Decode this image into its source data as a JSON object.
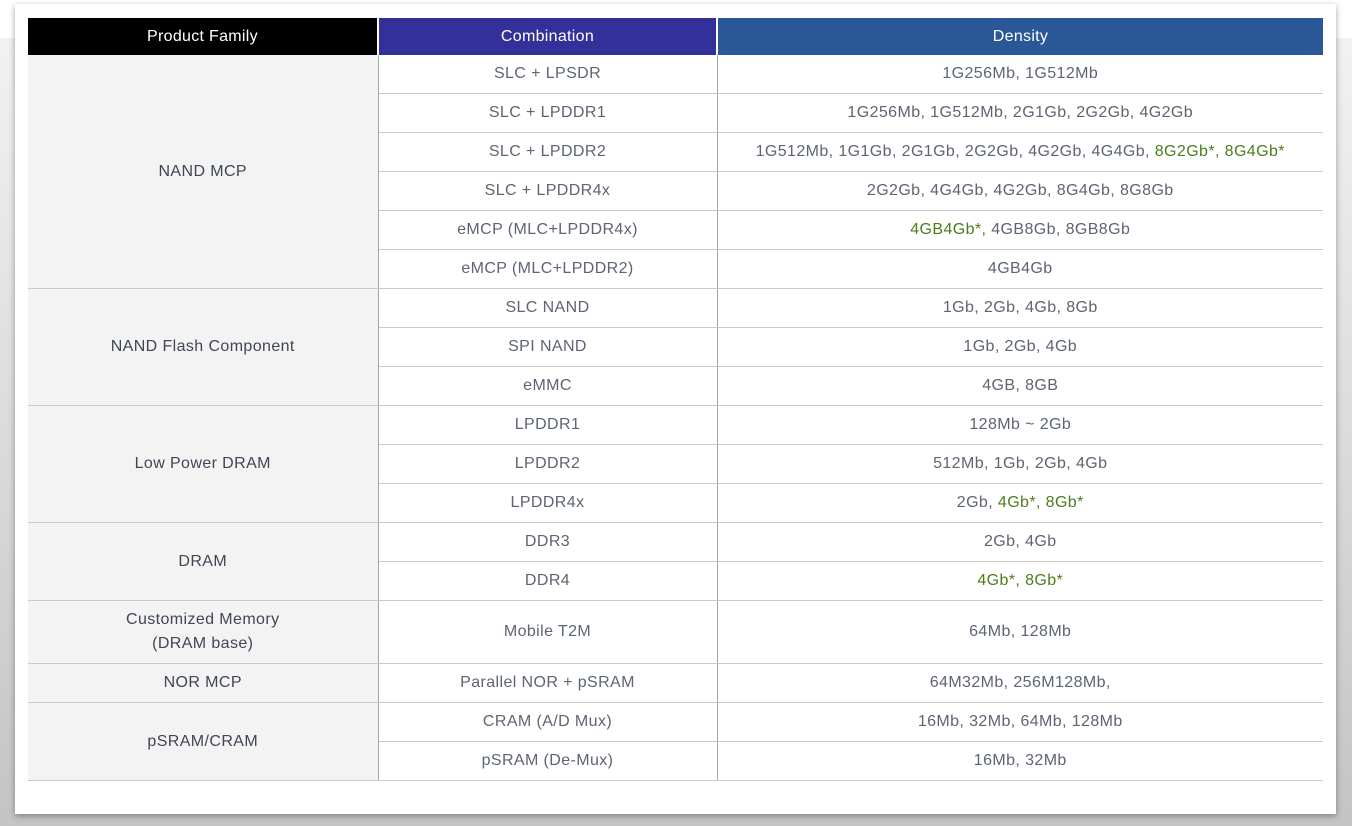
{
  "table": {
    "headers": [
      "Product Family",
      "Combination",
      "Density"
    ],
    "highlight_color": "#4d7c1c",
    "groups": [
      {
        "family": "NAND MCP",
        "rows": [
          {
            "combination": "SLC + LPSDR",
            "density": [
              {
                "text": "1G256Mb, 1G512Mb",
                "hl": false
              }
            ]
          },
          {
            "combination": "SLC + LPDDR1",
            "density": [
              {
                "text": "1G256Mb, 1G512Mb, 2G1Gb, 2G2Gb, 4G2Gb",
                "hl": false
              }
            ]
          },
          {
            "combination": "SLC + LPDDR2",
            "density": [
              {
                "text": "1G512Mb, 1G1Gb, 2G1Gb, 2G2Gb, 4G2Gb, 4G4Gb, ",
                "hl": false
              },
              {
                "text": "8G2Gb*, 8G4Gb*",
                "hl": true
              }
            ]
          },
          {
            "combination": "SLC + LPDDR4x",
            "density": [
              {
                "text": "2G2Gb, 4G4Gb, 4G2Gb, 8G4Gb, 8G8Gb",
                "hl": false
              }
            ]
          },
          {
            "combination": "eMCP (MLC+LPDDR4x)",
            "density": [
              {
                "text": "4GB4Gb*, ",
                "hl": true
              },
              {
                "text": "4GB8Gb, 8GB8Gb",
                "hl": false
              }
            ]
          },
          {
            "combination": "eMCP (MLC+LPDDR2)",
            "density": [
              {
                "text": "4GB4Gb",
                "hl": false
              }
            ]
          }
        ]
      },
      {
        "family": "NAND Flash Component",
        "rows": [
          {
            "combination": "SLC NAND",
            "density": [
              {
                "text": "1Gb, 2Gb, 4Gb, 8Gb",
                "hl": false
              }
            ]
          },
          {
            "combination": "SPI NAND",
            "density": [
              {
                "text": "1Gb, 2Gb, 4Gb",
                "hl": false
              }
            ]
          },
          {
            "combination": "eMMC",
            "density": [
              {
                "text": "4GB, 8GB",
                "hl": false
              }
            ]
          }
        ]
      },
      {
        "family": "Low Power DRAM",
        "rows": [
          {
            "combination": "LPDDR1",
            "density": [
              {
                "text": "128Mb ~ 2Gb",
                "hl": false
              }
            ]
          },
          {
            "combination": "LPDDR2",
            "density": [
              {
                "text": "512Mb, 1Gb, 2Gb, 4Gb",
                "hl": false
              }
            ]
          },
          {
            "combination": "LPDDR4x",
            "density": [
              {
                "text": "2Gb, ",
                "hl": false
              },
              {
                "text": "4Gb*, 8Gb*",
                "hl": true
              }
            ]
          }
        ]
      },
      {
        "family": "DRAM",
        "rows": [
          {
            "combination": "DDR3",
            "density": [
              {
                "text": "2Gb, 4Gb",
                "hl": false
              }
            ]
          },
          {
            "combination": "DDR4",
            "density": [
              {
                "text": "4Gb*, 8Gb*",
                "hl": true
              }
            ]
          }
        ]
      },
      {
        "family": "Customized Memory\n(DRAM base)",
        "rows": [
          {
            "combination": "Mobile T2M",
            "density": [
              {
                "text": "64Mb, 128Mb",
                "hl": false
              }
            ]
          }
        ]
      },
      {
        "family": "NOR MCP",
        "rows": [
          {
            "combination": "Parallel NOR + pSRAM",
            "density": [
              {
                "text": "64M32Mb, 256M128Mb,",
                "hl": false
              }
            ]
          }
        ]
      },
      {
        "family": "pSRAM/CRAM",
        "rows": [
          {
            "combination": "CRAM (A/D Mux)",
            "density": [
              {
                "text": "16Mb, 32Mb, 64Mb, 128Mb",
                "hl": false
              }
            ]
          },
          {
            "combination": "pSRAM (De-Mux)",
            "density": [
              {
                "text": "16Mb, 32Mb",
                "hl": false
              }
            ]
          }
        ]
      }
    ]
  }
}
